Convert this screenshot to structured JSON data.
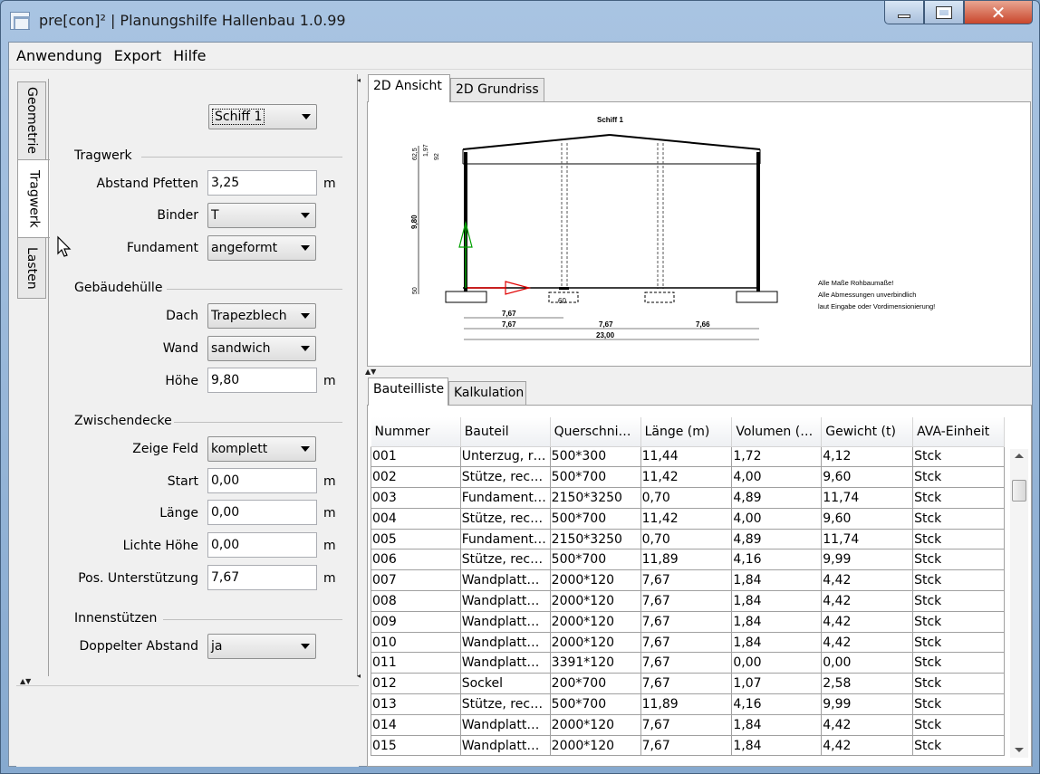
{
  "window": {
    "title": "pre[con]² | Planungshilfe Hallenbau 1.0.99"
  },
  "menu": [
    "Anwendung",
    "Export",
    "Hilfe"
  ],
  "side_tabs": [
    "Geometrie",
    "Tragwerk",
    "Lasten"
  ],
  "form": {
    "schiff_select": "Schiff 1",
    "tragwerk": {
      "heading": "Tragwerk",
      "abstand_pfetten_label": "Abstand Pfetten",
      "abstand_pfetten_value": "3,25",
      "abstand_pfetten_unit": "m",
      "binder_label": "Binder",
      "binder_value": "T",
      "fundament_label": "Fundament",
      "fundament_value": "angeformt"
    },
    "gebaeudehuelle": {
      "heading": "Gebäudehülle",
      "dach_label": "Dach",
      "dach_value": "Trapezblech",
      "wand_label": "Wand",
      "wand_value": "sandwich",
      "hoehe_label": "Höhe",
      "hoehe_value": "9,80",
      "hoehe_unit": "m"
    },
    "zwischendecke": {
      "heading": "Zwischendecke",
      "zeige_feld_label": "Zeige Feld",
      "zeige_feld_value": "komplett",
      "start_label": "Start",
      "start_value": "0,00",
      "start_unit": "m",
      "laenge_label": "Länge",
      "laenge_value": "0,00",
      "laenge_unit": "m",
      "lichte_hoehe_label": "Lichte Höhe",
      "lichte_hoehe_value": "0,00",
      "lichte_hoehe_unit": "m",
      "pos_unterstuetzung_label": "Pos. Unterstützung",
      "pos_unterstuetzung_value": "7,67",
      "pos_unterstuetzung_unit": "m"
    },
    "innenstuetzen": {
      "heading": "Innenstützen",
      "doppelter_abstand_label": "Doppelter Abstand",
      "doppelter_abstand_value": "ja"
    }
  },
  "view_tabs": [
    "2D Ansicht",
    "2D Grundriss"
  ],
  "drawing": {
    "title": "Schiff 1",
    "dim_top": [
      "62,5",
      "1,97",
      "92"
    ],
    "dim_height": "9,80",
    "dim_base": "50",
    "dim_found": "60",
    "dim_row1": "7,67",
    "dim_row2": [
      "7,67",
      "7,67",
      "7,66"
    ],
    "dim_total": "23,00",
    "notes": [
      "Alle Maße Rohbaumaße!",
      "Alle Abmessungen unverbindlich",
      "laut Eingabe oder Vordimensionierung!"
    ]
  },
  "list_tabs": [
    "Bauteilliste",
    "Kalkulation"
  ],
  "table": {
    "columns": [
      "Nummer",
      "Bauteil",
      "Querschni…",
      "Länge (m)",
      "Volumen (…",
      "Gewicht (t)",
      "AVA-Einheit"
    ],
    "rows": [
      [
        "001",
        "Unterzug, r…",
        "500*300",
        "11,44",
        "1,72",
        "4,12",
        "Stck"
      ],
      [
        "002",
        "Stütze, rec…",
        "500*700",
        "11,42",
        "4,00",
        "9,60",
        "Stck"
      ],
      [
        "003",
        "Fundament…",
        "2150*3250",
        "0,70",
        "4,89",
        "11,74",
        "Stck"
      ],
      [
        "004",
        "Stütze, rec…",
        "500*700",
        "11,42",
        "4,00",
        "9,60",
        "Stck"
      ],
      [
        "005",
        "Fundament…",
        "2150*3250",
        "0,70",
        "4,89",
        "11,74",
        "Stck"
      ],
      [
        "006",
        "Stütze, rec…",
        "500*700",
        "11,89",
        "4,16",
        "9,99",
        "Stck"
      ],
      [
        "007",
        "Wandplatt…",
        "2000*120",
        "7,67",
        "1,84",
        "4,42",
        "Stck"
      ],
      [
        "008",
        "Wandplatt…",
        "2000*120",
        "7,67",
        "1,84",
        "4,42",
        "Stck"
      ],
      [
        "009",
        "Wandplatt…",
        "2000*120",
        "7,67",
        "1,84",
        "4,42",
        "Stck"
      ],
      [
        "010",
        "Wandplatt…",
        "2000*120",
        "7,67",
        "1,84",
        "4,42",
        "Stck"
      ],
      [
        "011",
        "Wandplatt…",
        "3391*120",
        "7,67",
        "0,00",
        "0,00",
        "Stck"
      ],
      [
        "012",
        "Sockel",
        "200*700",
        "7,67",
        "1,07",
        "2,58",
        "Stck"
      ],
      [
        "013",
        "Stütze, rec…",
        "500*700",
        "11,89",
        "4,16",
        "9,99",
        "Stck"
      ],
      [
        "014",
        "Wandplatt…",
        "2000*120",
        "7,67",
        "1,84",
        "4,42",
        "Stck"
      ],
      [
        "015",
        "Wandplatt…",
        "2000*120",
        "7,67",
        "1,84",
        "4,42",
        "Stck"
      ]
    ]
  }
}
